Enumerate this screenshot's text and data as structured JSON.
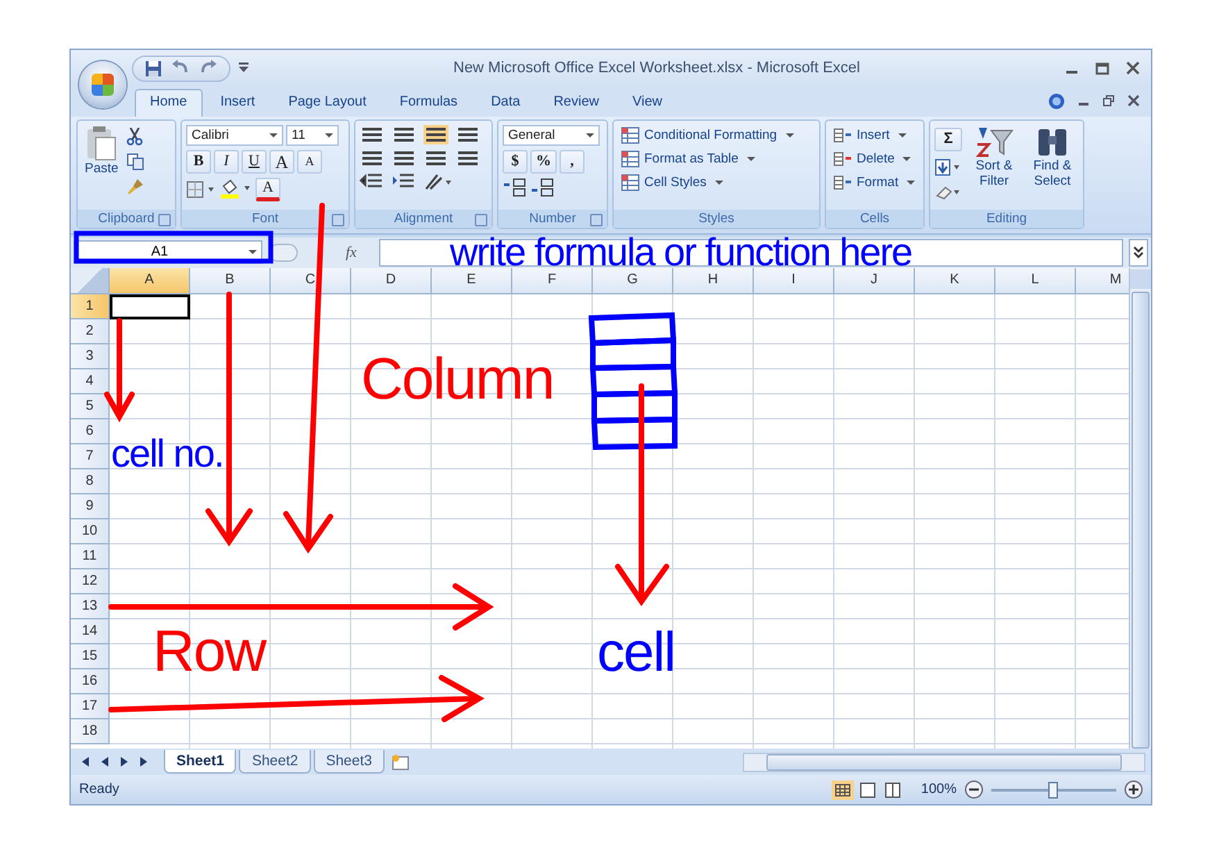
{
  "window": {
    "title": "New Microsoft Office Excel Worksheet.xlsx - Microsoft Excel"
  },
  "tabs": [
    {
      "label": "Home",
      "selected": true
    },
    {
      "label": "Insert",
      "selected": false
    },
    {
      "label": "Page Layout",
      "selected": false
    },
    {
      "label": "Formulas",
      "selected": false
    },
    {
      "label": "Data",
      "selected": false
    },
    {
      "label": "Review",
      "selected": false
    },
    {
      "label": "View",
      "selected": false
    }
  ],
  "ribbon": {
    "clipboard": {
      "paste": "Paste",
      "label": "Clipboard"
    },
    "font": {
      "font_name": "Calibri",
      "font_size": "11",
      "bold": "B",
      "italic": "I",
      "underline": "U",
      "grow": "A",
      "shrink": "A",
      "font_color_button": "A",
      "label": "Font"
    },
    "alignment": {
      "label": "Alignment"
    },
    "number": {
      "format": "General",
      "buttons": [
        "$",
        "%",
        ","
      ],
      "label": "Number"
    },
    "styles": {
      "items": [
        "Conditional Formatting",
        "Format as Table",
        "Cell Styles"
      ],
      "label": "Styles"
    },
    "cells": {
      "items": [
        "Insert",
        "Delete",
        "Format"
      ],
      "label": "Cells"
    },
    "editing": {
      "sum": "Σ",
      "items": [
        "Sort & Filter",
        "Find & Select"
      ],
      "label": "Editing"
    }
  },
  "formula_bar": {
    "name_box": "A1",
    "function_label": "fx"
  },
  "columns": [
    {
      "label": "A",
      "selected": true
    },
    {
      "label": "B",
      "selected": false
    },
    {
      "label": "C",
      "selected": false
    },
    {
      "label": "D",
      "selected": false
    },
    {
      "label": "E",
      "selected": false
    },
    {
      "label": "F",
      "selected": false
    },
    {
      "label": "G",
      "selected": false
    },
    {
      "label": "H",
      "selected": false
    },
    {
      "label": "I",
      "selected": false
    },
    {
      "label": "J",
      "selected": false
    },
    {
      "label": "K",
      "selected": false
    },
    {
      "label": "L",
      "selected": false
    },
    {
      "label": "M",
      "selected": false
    }
  ],
  "rows": [
    {
      "label": "1",
      "selected": true
    },
    {
      "label": "2",
      "selected": false
    },
    {
      "label": "3",
      "selected": false
    },
    {
      "label": "4",
      "selected": false
    },
    {
      "label": "5",
      "selected": false
    },
    {
      "label": "6",
      "selected": false
    },
    {
      "label": "7",
      "selected": false
    },
    {
      "label": "8",
      "selected": false
    },
    {
      "label": "9",
      "selected": false
    },
    {
      "label": "10",
      "selected": false
    },
    {
      "label": "11",
      "selected": false
    },
    {
      "label": "12",
      "selected": false
    },
    {
      "label": "13",
      "selected": false
    },
    {
      "label": "14",
      "selected": false
    },
    {
      "label": "15",
      "selected": false
    },
    {
      "label": "16",
      "selected": false
    },
    {
      "label": "17",
      "selected": false
    },
    {
      "label": "18",
      "selected": false
    }
  ],
  "sheets": [
    {
      "label": "Sheet1",
      "selected": true
    },
    {
      "label": "Sheet2",
      "selected": false
    },
    {
      "label": "Sheet3",
      "selected": false
    }
  ],
  "status_bar": {
    "status": "Ready",
    "zoom": "100%",
    "zoom_slider": {
      "level": 0.5
    }
  },
  "annotations": [
    {
      "text": "write formula or function here",
      "color": "#0000ff"
    },
    {
      "text": "Column",
      "color": "#ff0000"
    },
    {
      "text": "cell no.",
      "color": "#0000ff"
    },
    {
      "text": "Row",
      "color": "#ff0000"
    },
    {
      "text": "cell",
      "color": "#0000ff"
    }
  ]
}
